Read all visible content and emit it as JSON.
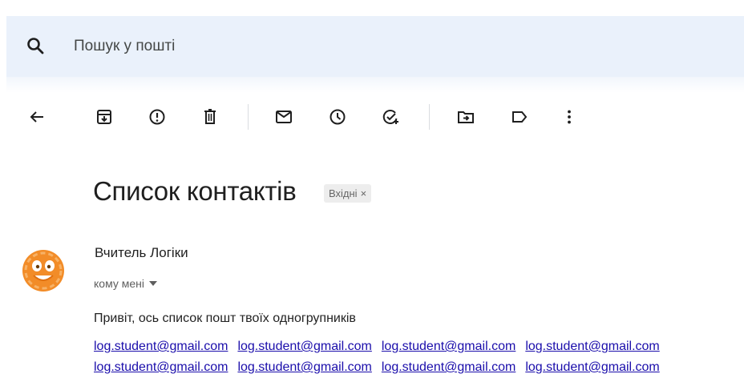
{
  "search": {
    "placeholder": "Пошук у пошті"
  },
  "toolbar": {
    "icons": [
      "back-arrow-icon",
      "archive-icon",
      "report-spam-icon",
      "delete-icon",
      "mark-unread-icon",
      "snooze-icon",
      "add-task-icon",
      "move-to-icon",
      "label-icon",
      "more-vert-icon"
    ]
  },
  "message": {
    "subject": "Список контактів",
    "label": "Вхідні",
    "label_close": "×",
    "sender": "Вчитель Логіки",
    "recipient": "кому мені",
    "body": "Привіт, ось список пошт твоїх одногрупників",
    "emails": [
      [
        "log.student@gmail.com",
        "log.student@gmail.com",
        "log.student@gmail.com",
        "log.student@gmail.com"
      ],
      [
        "log.student@gmail.com",
        "log.student@gmail.com",
        "log.student@gmail.com",
        "log.student@gmail.com"
      ]
    ]
  },
  "colors": {
    "search_bg": "#eaf1fb",
    "link": "#1a0dab",
    "avatar": "#f28c28"
  }
}
